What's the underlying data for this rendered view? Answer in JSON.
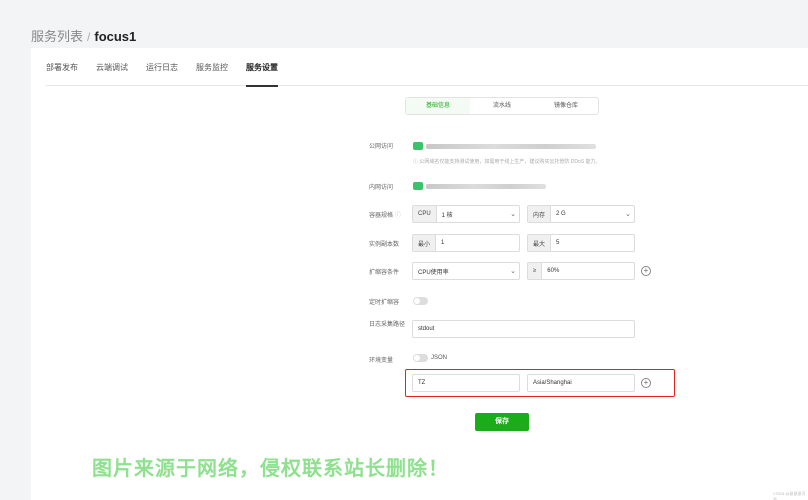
{
  "breadcrumb": {
    "parent": "服务列表",
    "separator": "/",
    "current": "focus1"
  },
  "tabs": [
    "部署发布",
    "云端调试",
    "运行日志",
    "服务监控",
    "服务设置"
  ],
  "segments": [
    "基础信息",
    "流水线",
    "镜像仓库"
  ],
  "form": {
    "public_access_label": "公网访问",
    "public_hint": "ⓘ 公网域名仅能支持测试使用，如需用于线上生产，建议购买云托管防 DDoS 能力。",
    "internal_access_label": "内网访问",
    "spec_label": "容器规格",
    "spec_info": "ⓘ",
    "cpu_prefix": "CPU",
    "cpu_value": "1 核",
    "mem_prefix": "内存",
    "mem_value": "2 G",
    "replicas_label": "实例副本数",
    "min_prefix": "最小",
    "min_value": "1",
    "max_prefix": "最大",
    "max_value": "5",
    "scale_label": "扩缩容条件",
    "scale_metric": "CPU使用率",
    "scale_op": "≥",
    "scale_value": "60%",
    "cron_scale_label": "定时扩缩容",
    "log_path_label": "日志采集路径",
    "log_path_value": "stdout",
    "env_label": "环境变量",
    "json_label": "JSON",
    "env_key": "TZ",
    "env_value": "Asia/Shanghai",
    "save_label": "保存"
  },
  "watermark": "图片来源于网络，侵权联系站长删除！",
  "footnote": "CSDN @鼠鼠很可爱",
  "colors": {
    "accent": "#1aad19",
    "highlight": "#e0241e"
  }
}
